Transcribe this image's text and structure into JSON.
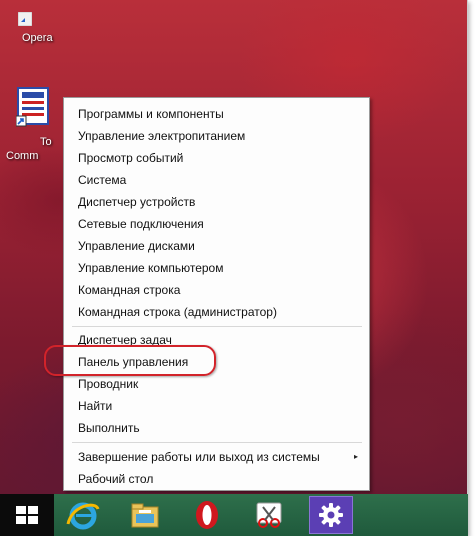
{
  "desktop": {
    "icons": [
      {
        "name": "opera-shortcut",
        "label": "Opera"
      },
      {
        "name": "total-commander-shortcut",
        "label_line1": "To",
        "label_line2": "Comm"
      }
    ]
  },
  "context_menu": {
    "group1": [
      "Программы и компоненты",
      "Управление электропитанием",
      "Просмотр событий",
      "Система",
      "Диспетчер устройств",
      "Сетевые подключения",
      "Управление дисками",
      "Управление компьютером",
      "Командная строка",
      "Командная строка (администратор)"
    ],
    "group2": [
      "Диспетчер задач",
      "Панель управления",
      "Проводник",
      "Найти",
      "Выполнить"
    ],
    "group3": [
      {
        "label": "Завершение работы или выход из системы",
        "submenu_arrow": "▸"
      },
      {
        "label": "Рабочий стол"
      }
    ],
    "highlighted_item": "Панель управления",
    "highlight_color": "#d2232a"
  },
  "taskbar": {
    "buttons": [
      {
        "icon": "windows-start-icon"
      },
      {
        "icon": "internet-explorer-icon"
      },
      {
        "icon": "file-explorer-icon"
      },
      {
        "icon": "opera-icon"
      },
      {
        "icon": "snipping-tool-icon"
      },
      {
        "icon": "settings-gear-icon",
        "active": true
      }
    ],
    "accent_color": "#5b3fb4"
  }
}
